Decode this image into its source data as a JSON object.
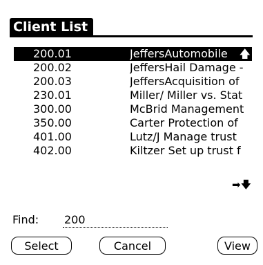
{
  "title": "Client List",
  "clients": [
    {
      "number": "200.01",
      "description": "JeffersAutomobile",
      "selected": true
    },
    {
      "number": "200.02",
      "description": "JeffersHail Damage -",
      "selected": false
    },
    {
      "number": "200.03",
      "description": "JeffersAcquisition of",
      "selected": false
    },
    {
      "number": "230.01",
      "description": "Miller/ Miller vs. Stat",
      "selected": false
    },
    {
      "number": "300.00",
      "description": "McBrid Management",
      "selected": false
    },
    {
      "number": "350.00",
      "description": "Carter  Protection of",
      "selected": false
    },
    {
      "number": "401.00",
      "description": "Lutz/J Manage trust",
      "selected": false
    },
    {
      "number": "402.00",
      "description": "Kiltzer  Set up trust f",
      "selected": false
    }
  ],
  "find": {
    "label": "Find:",
    "value": "200"
  },
  "buttons": {
    "select": "Select",
    "cancel": "Cancel",
    "view": "View"
  },
  "icons": {
    "selected_row_arrow": "up-arrow-icon",
    "scroll_right": "right-arrow-icon",
    "scroll_down": "down-arrow-icon"
  }
}
